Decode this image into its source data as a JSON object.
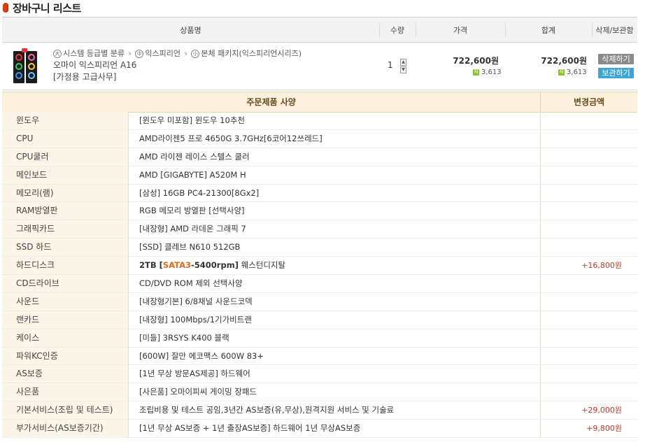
{
  "page": {
    "title": "장바구니 리스트"
  },
  "cart": {
    "headers": [
      "상품명",
      "수량",
      "가격",
      "합계",
      "삭제/보관함"
    ],
    "item": {
      "cat1_icon": "大",
      "cat1": "시스템 등급별 분류",
      "cat2_icon": "中",
      "cat2": "익스피리언",
      "cat3_icon": "小",
      "cat3": "본체 패키지(익스피리언시리즈)",
      "name": "오마이 익스피리언 A16",
      "subtitle": "[가정용 고급사무]",
      "qty": "1",
      "price": "722,600원",
      "price_points": "3,613",
      "total": "722,600원",
      "total_points": "3,613",
      "points_icon": "적",
      "delete_label": "삭제하기",
      "keep_label": "보관하기"
    }
  },
  "specs": {
    "header": "주문제품 사양",
    "header_amount": "변경금액",
    "rows": [
      {
        "label": "윈도우",
        "value": "[윈도우 미포함] 윈도우 10추천",
        "amount": ""
      },
      {
        "label": "CPU",
        "value": "AMD라이젠5 프로 4650G 3.7GHz[6코어12쓰레드]",
        "amount": ""
      },
      {
        "label": "CPU쿨러",
        "value": "AMD 라이젠 레이스 스텔스 쿨러",
        "amount": ""
      },
      {
        "label": "메인보드",
        "value": "AMD [GIGABYTE] A520M H",
        "amount": ""
      },
      {
        "label": "메모리(램)",
        "value": "[삼성] 16GB PC4-21300[8Gx2]",
        "amount": ""
      },
      {
        "label": "RAM방열판",
        "value": "RGB 메모리 방열판 [선택사양]",
        "amount": ""
      },
      {
        "label": "그래픽카드",
        "value": "[내장형] AMD 라데온 그래픽 7",
        "amount": ""
      },
      {
        "label": "SSD 하드",
        "value": "[SSD] 클레브 N610 512GB",
        "amount": ""
      },
      {
        "label": "하드디스크",
        "value": "",
        "amount": "+16,800원"
      },
      {
        "label": "CD드라이브",
        "value": "CD/DVD ROM 제외 선택사양",
        "amount": ""
      },
      {
        "label": "사운드",
        "value": "[내장형기본] 6/8채널 사운드코덱",
        "amount": ""
      },
      {
        "label": "랜카드",
        "value": "[내장형] 100Mbps/1기가비트랜",
        "amount": ""
      },
      {
        "label": "케이스",
        "value": "[미들] 3RSYS K400 블랙",
        "amount": ""
      },
      {
        "label": "파워KC인증",
        "value": "[600W] 잘만 에코맥스 600W 83+",
        "amount": ""
      },
      {
        "label": "AS보증",
        "value": "[1년 무상 방문AS제공] 하드웨어",
        "amount": ""
      },
      {
        "label": "사은품",
        "value": "[사은품] 오마이피씨 게이밍 장패드",
        "amount": ""
      },
      {
        "label": "기본서비스(조립 및 테스트)",
        "value": "조립비용 및 테스트 공임,3년간 AS보증(유,무상),원격지원 서비스 및 기술료",
        "amount": "+29,000원"
      },
      {
        "label": "부가서비스(AS보증기간)",
        "value": "[1년 무상 AS보증 + 1년 출장AS보증] 하드웨어 1년 무상AS보증",
        "amount": "+9,800원"
      }
    ],
    "hdd_value": {
      "part1": "2TB [",
      "part2": "SATA3",
      "part3": "-5400rpm]",
      "part4": " 웨스턴디지탈"
    }
  }
}
